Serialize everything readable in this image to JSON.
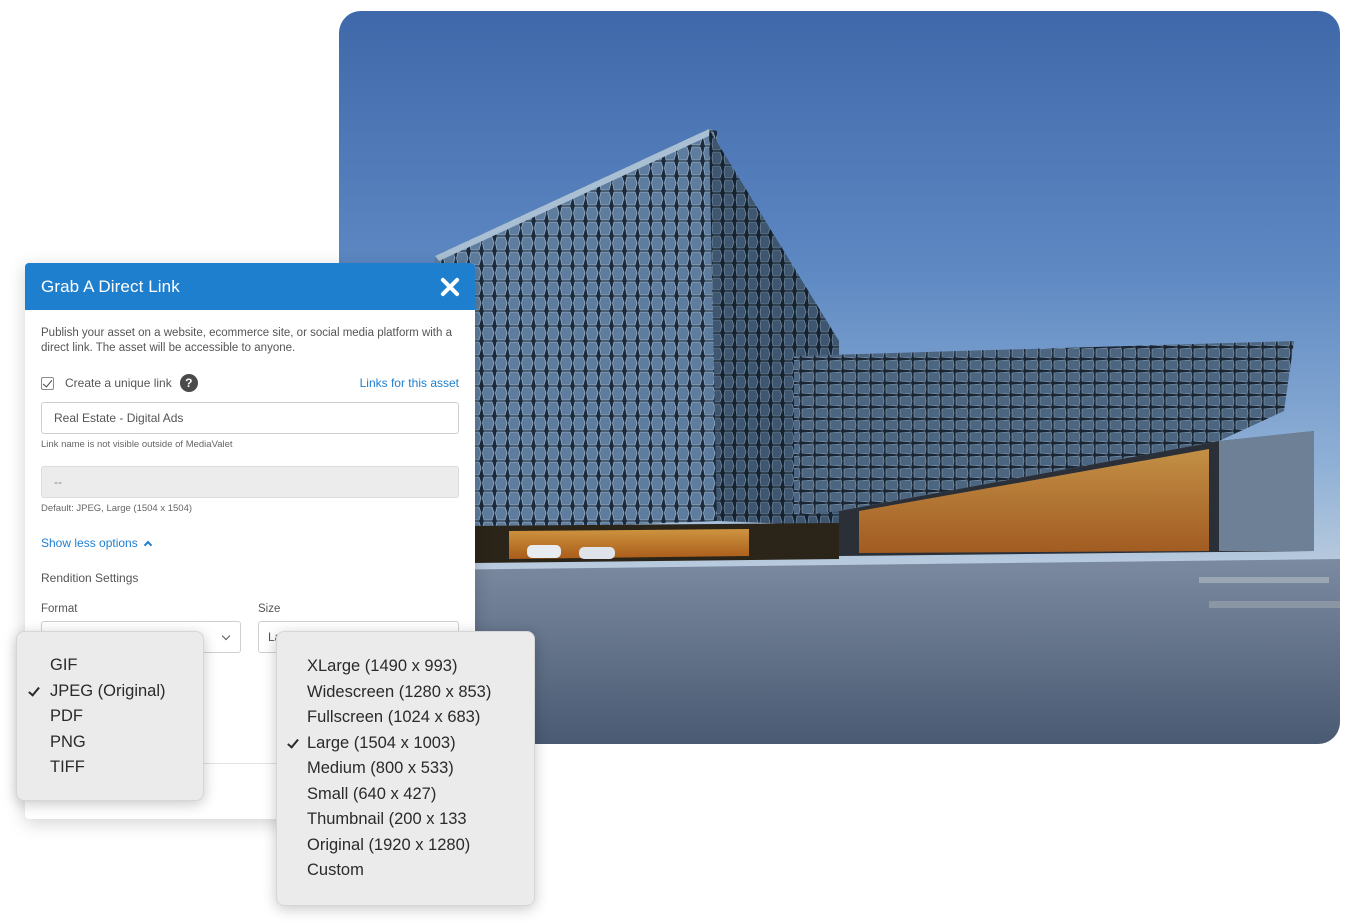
{
  "dialog": {
    "title": "Grab A Direct Link",
    "description": "Publish your asset on a website, ecommerce site, or social media platform with a direct link. The asset will be accessible to anyone.",
    "create_unique_link_label": "Create a unique link",
    "create_unique_link_checked": true,
    "help_glyph": "?",
    "links_for_asset_label": "Links for this asset",
    "link_name_value": "Real Estate - Digital Ads",
    "link_name_hint": "Link name is not visible outside of MediaValet",
    "url_value": "--",
    "default_hint": "Default: JPEG, Large (1504 x 1504)",
    "show_less_label": "Show less options",
    "rendition_title": "Rendition Settings",
    "format_label": "Format",
    "size_label": "Size",
    "size_value_partial": "La"
  },
  "format_menu": {
    "items": [
      {
        "label": "GIF",
        "selected": false
      },
      {
        "label": "JPEG (Original)",
        "selected": true
      },
      {
        "label": "PDF",
        "selected": false
      },
      {
        "label": "PNG",
        "selected": false
      },
      {
        "label": "TIFF",
        "selected": false
      }
    ]
  },
  "size_menu": {
    "items": [
      {
        "label": "XLarge (1490 x 993)",
        "selected": false
      },
      {
        "label": "Widescreen (1280 x 853)",
        "selected": false
      },
      {
        "label": "Fullscreen (1024 x 683)",
        "selected": false
      },
      {
        "label": "Large (1504 x 1003)",
        "selected": true
      },
      {
        "label": "Medium (800 x 533)",
        "selected": false
      },
      {
        "label": "Small (640 x 427)",
        "selected": false
      },
      {
        "label": "Thumbnail (200 x 133",
        "selected": false
      },
      {
        "label": "Original (1920 x 1280)",
        "selected": false
      },
      {
        "label": "Custom",
        "selected": false
      }
    ]
  },
  "colors": {
    "accent": "#1f7fcf",
    "sky_top": "#3f68aa",
    "plaza": "#5d6f86"
  },
  "icons": {
    "close": "close-icon",
    "help": "help-icon",
    "check": "check-icon",
    "chevron_up": "chevron-up-icon",
    "chevron_down": "chevron-down-icon"
  }
}
